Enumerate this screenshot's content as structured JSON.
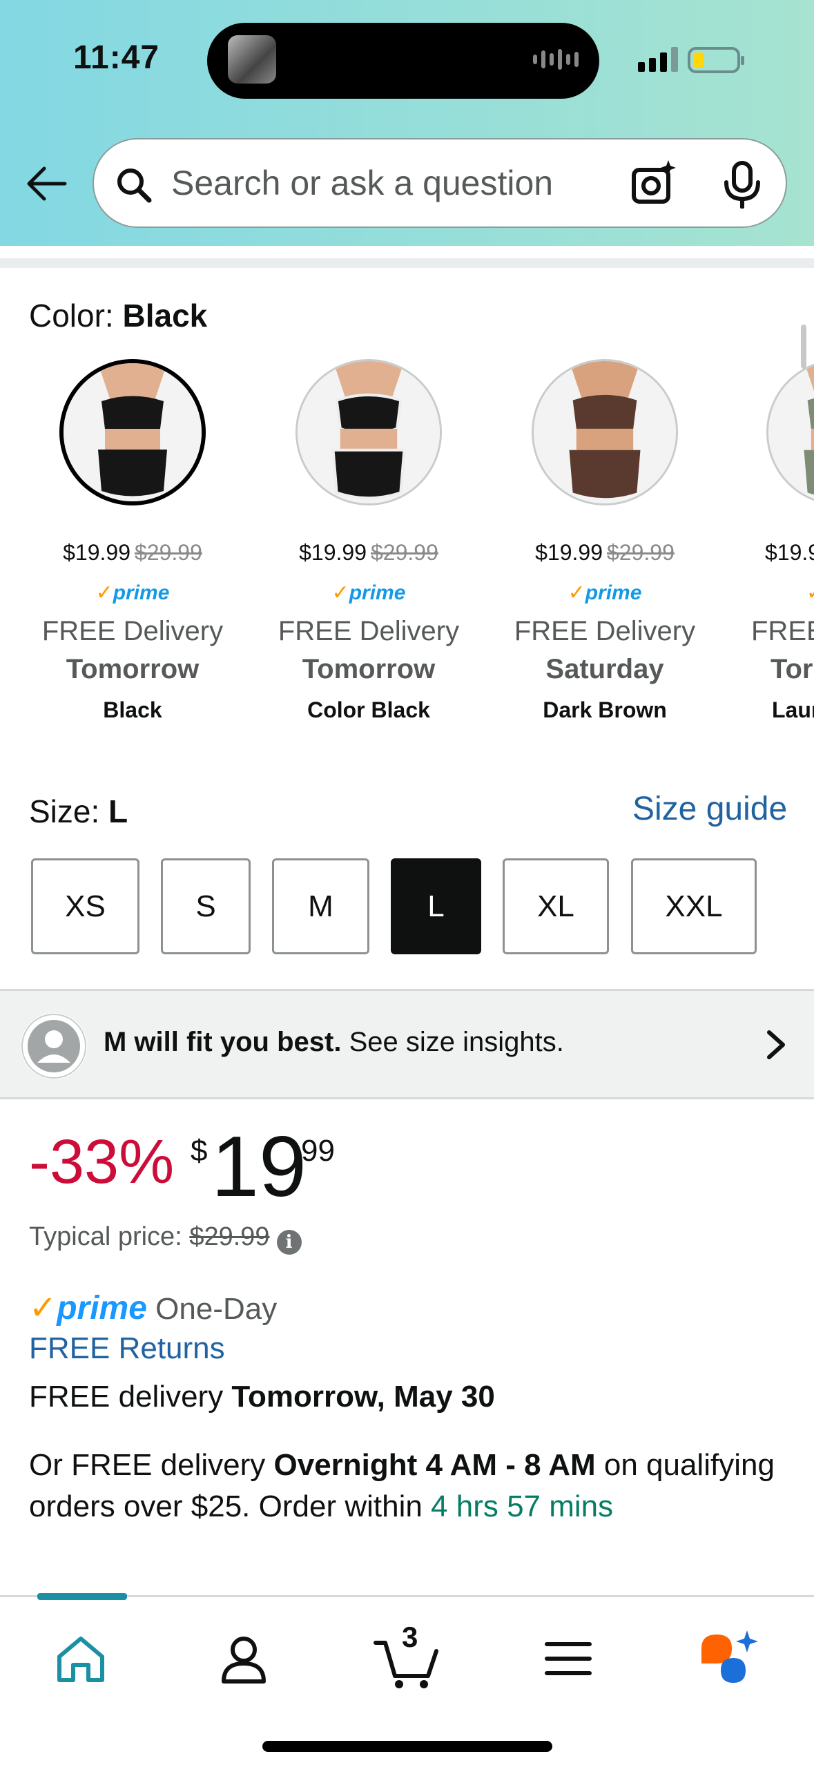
{
  "status_bar": {
    "time": "11:47"
  },
  "search": {
    "placeholder": "Search or ask a question"
  },
  "color_section": {
    "label": "Color:",
    "selected": "Black",
    "variants": [
      {
        "price": "$19.99",
        "list_price": "$29.99",
        "prime": "prime",
        "delivery": "FREE Delivery",
        "day": "Tomorrow",
        "name": "Black",
        "selected": true
      },
      {
        "price": "$19.99",
        "list_price": "$29.99",
        "prime": "prime",
        "delivery": "FREE Delivery",
        "day": "Tomorrow",
        "name": "Color Black",
        "selected": false
      },
      {
        "price": "$19.99",
        "list_price": "$29.99",
        "prime": "prime",
        "delivery": "FREE Delivery",
        "day": "Saturday",
        "name": "Dark Brown",
        "selected": false
      },
      {
        "price": "$19.9",
        "list_price": "",
        "prime": "",
        "delivery": "FREE",
        "day": "Tor",
        "name": "Laur",
        "selected": false
      }
    ]
  },
  "size_section": {
    "label": "Size:",
    "selected": "L",
    "guide_link": "Size guide",
    "sizes": [
      "XS",
      "S",
      "M",
      "L",
      "XL",
      "XXL"
    ]
  },
  "fit_banner": {
    "bold": "M will fit you best.",
    "text": " See size insights."
  },
  "pricing": {
    "discount": "-33%",
    "currency": "$",
    "whole": "19",
    "fraction": "99",
    "typical_label": "Typical price:",
    "typical_price": "$29.99"
  },
  "delivery": {
    "prime_check": "✓",
    "prime_word": "prime",
    "prime_speed": "One-Day",
    "returns": "FREE Returns",
    "free_delivery_prefix": "FREE delivery ",
    "free_delivery_date": "Tomorrow, May 30",
    "overnight_prefix": "Or FREE delivery ",
    "overnight_window": "Overnight 4 AM - 8 AM",
    "overnight_mid": " on qualifying orders over $25. Order within ",
    "overnight_countdown": "4 hrs 57 mins"
  },
  "bottom_nav": {
    "cart_count": "3"
  },
  "colors": {
    "accent_teal": "#1b8fa3",
    "link_blue": "#2162a1",
    "deal_red": "#cc0c39",
    "prime_blue": "#1a98ff",
    "prime_orange": "#ff9900",
    "countdown_green": "#067d62"
  }
}
